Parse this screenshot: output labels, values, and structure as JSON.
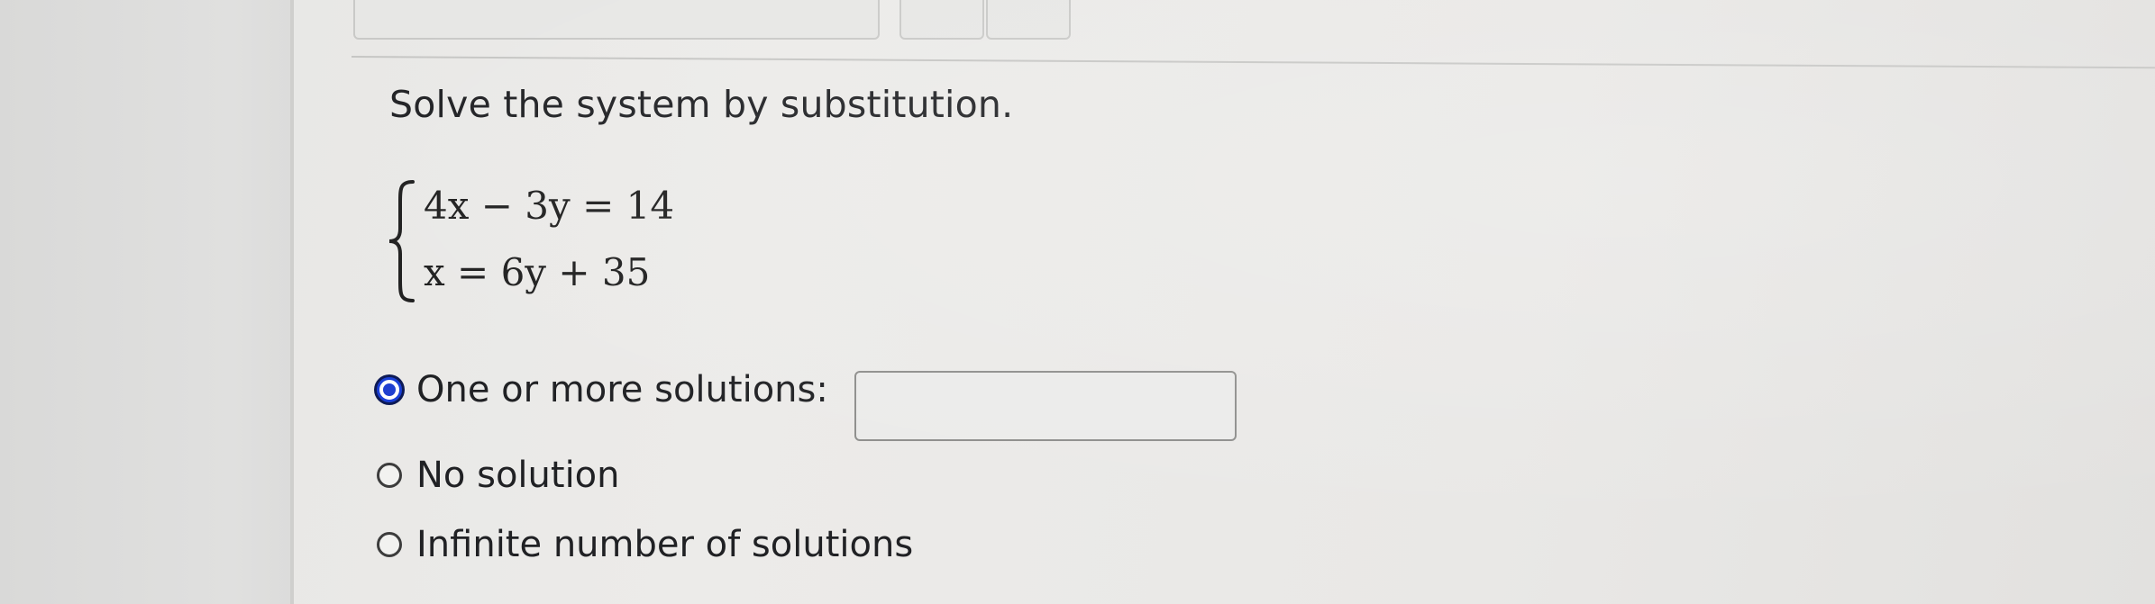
{
  "question": {
    "prompt": "Solve the system by substitution.",
    "equations": [
      "4x − 3y = 14",
      "x = 6y + 35"
    ]
  },
  "options": [
    {
      "label": "One or more solutions:",
      "selected": true
    },
    {
      "label": "No solution",
      "selected": false
    },
    {
      "label": "Infinite number of solutions",
      "selected": false
    }
  ],
  "answer": {
    "value": "",
    "placeholder": ""
  },
  "colors": {
    "radio_selected": "#1f3fd0",
    "text": "#202124"
  }
}
